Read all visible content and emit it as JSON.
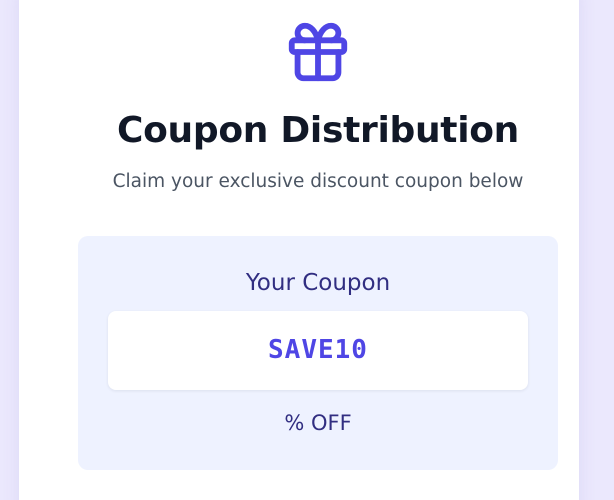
{
  "card": {
    "icon": "gift-icon",
    "title": "Coupon Distribution",
    "subtitle": "Claim your exclusive discount coupon below"
  },
  "coupon": {
    "heading": "Your Coupon",
    "code": "SAVE10",
    "discount": "% OFF"
  },
  "colors": {
    "background": "#ebe8fd",
    "accent": "#4f46e5",
    "panel": "#eef2ff",
    "heading_text": "#312e81",
    "title_text": "#111827"
  }
}
